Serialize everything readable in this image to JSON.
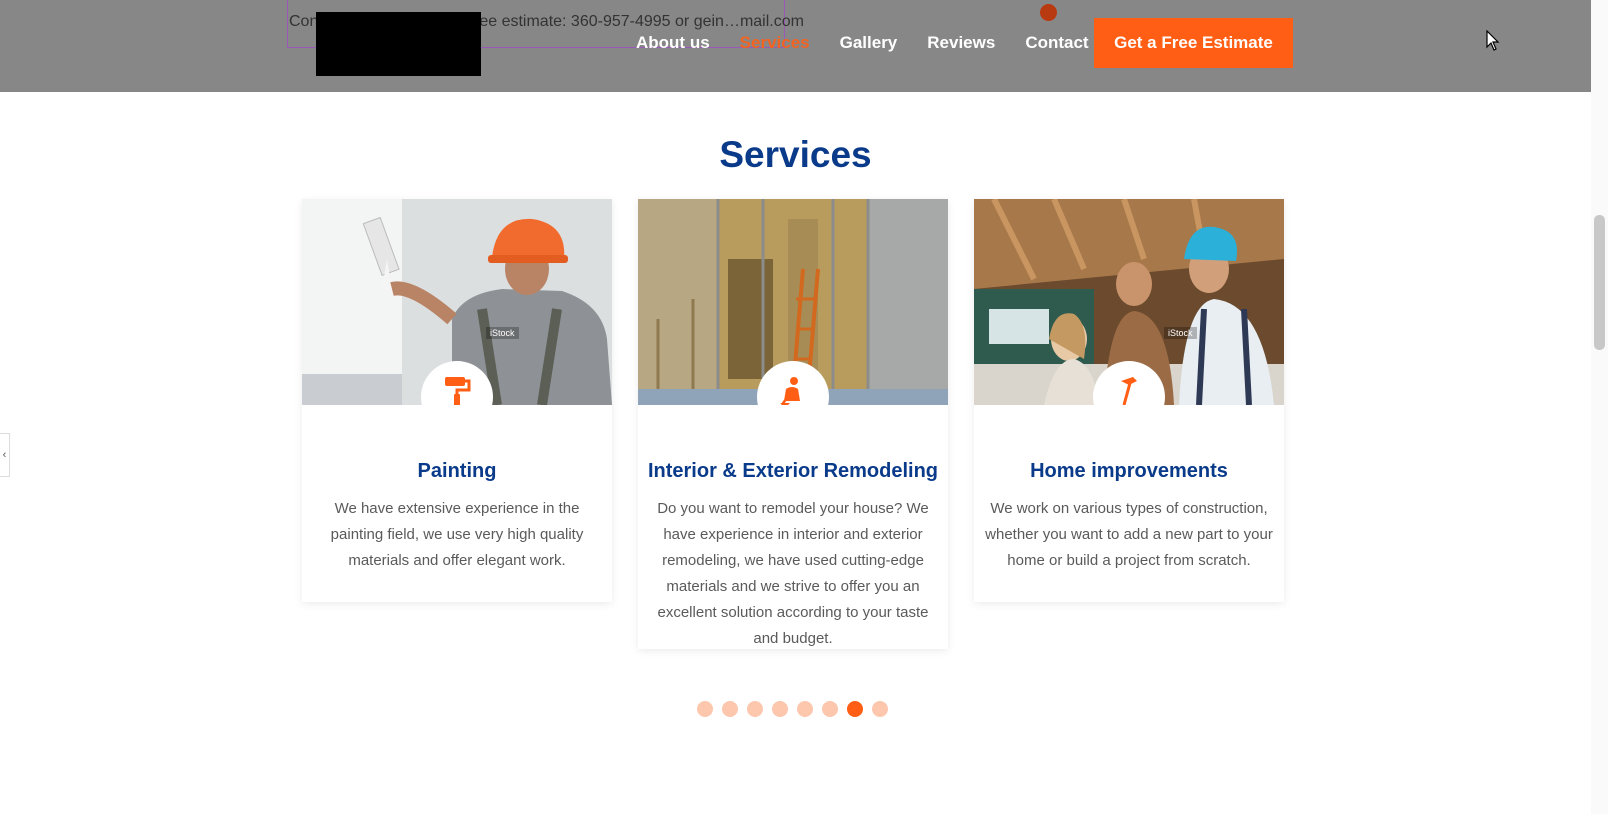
{
  "header": {
    "contact_text": "Contact us to schedule a free estimate: 360-957-4995 or gein…mail.com",
    "nav": [
      {
        "label": "About us",
        "active": false
      },
      {
        "label": "Services",
        "active": true
      },
      {
        "label": "Gallery",
        "active": false
      },
      {
        "label": "Reviews",
        "active": false
      },
      {
        "label": "Contact",
        "active": false
      }
    ],
    "cta_label": "Get a Free Estimate"
  },
  "section": {
    "title": "Services"
  },
  "cards": [
    {
      "icon": "paint-roller-icon",
      "watermark": "iStock",
      "title": "Painting",
      "description": "We have extensive experience in the painting field, we use very high quality materials and offer elegant work."
    },
    {
      "icon": "worker-digging-icon",
      "watermark": "",
      "title": "Interior & Exterior Remodeling",
      "description": "Do you want to remodel your house? We have experience in interior and exterior remodeling, we have used cutting-edge materials and we strive to offer you an excellent solution according to your taste and budget."
    },
    {
      "icon": "hammer-icon",
      "watermark": "iStock",
      "title": "Home improvements",
      "description": "We work on various types of construction, whether you want to add a new part to your home or build a project from scratch."
    }
  ],
  "pagination": {
    "total": 8,
    "active_index": 6
  },
  "side_tab": {
    "label": "‹"
  },
  "colors": {
    "accent": "#ff5e14",
    "title_blue": "#0a3a8a",
    "header_bg": "#878787"
  }
}
